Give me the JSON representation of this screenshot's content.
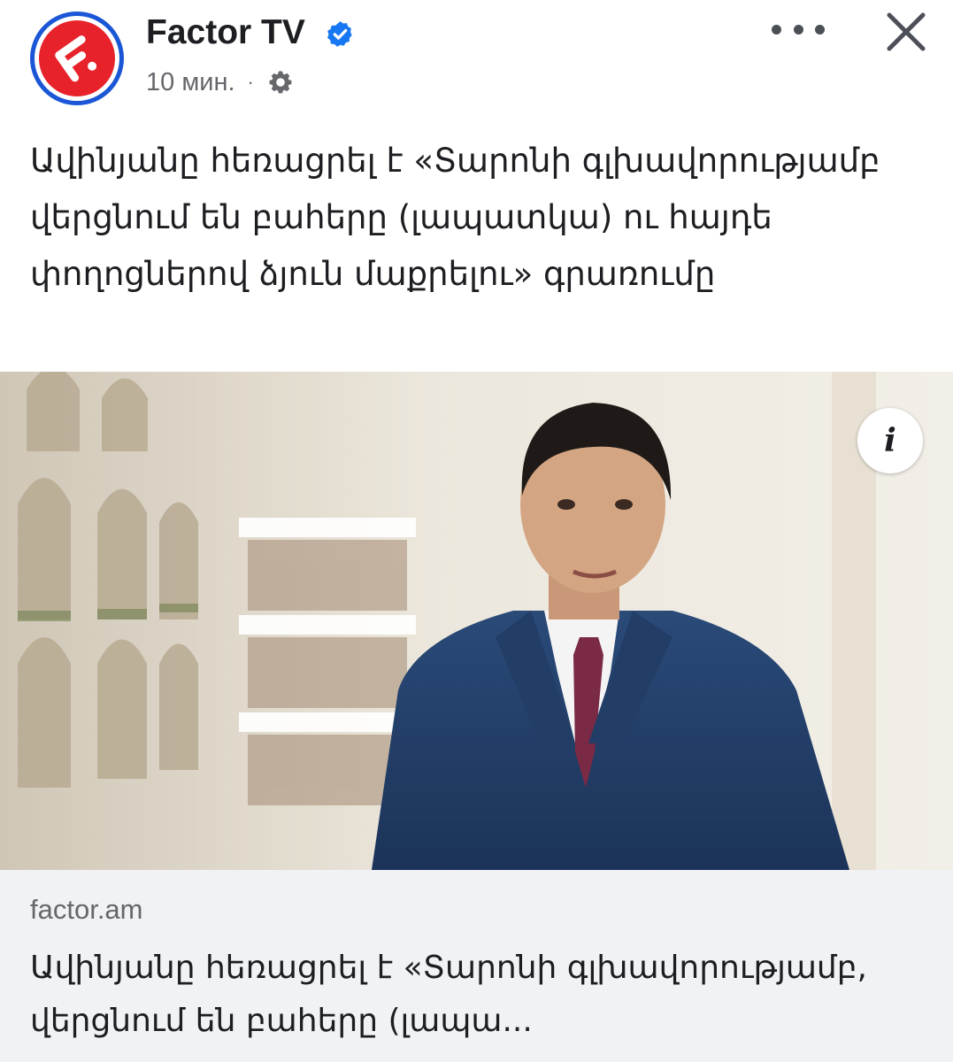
{
  "post": {
    "author": "Factor TV",
    "time": "10 мин.",
    "separator": "·",
    "text": "Ավինյանը հեռացրել է «Տարոնի գլխավորությամբ վերցնում են բահերը (լապատկա) ու հայդե փողոցներով ձյուն մաքրելու» գրառումը"
  },
  "icons": {
    "avatar": "factor-tv-logo",
    "verified": "verified-badge-icon",
    "privacy": "gear-icon",
    "more": "more-options-icon",
    "close": "close-icon",
    "info": "info-icon"
  },
  "image": {
    "info_label": "i"
  },
  "link_preview": {
    "domain": "factor.am",
    "title": "Ավինյանը հեռացրել է «Տարոնի գլխավորությամբ, վերցնում են բահերը (լապա..."
  },
  "colors": {
    "brand_red": "#e8222b",
    "avatar_ring": "#1a56d6",
    "verified_blue": "#1877f2",
    "muted_text": "#65676b",
    "preview_bg": "#f0f2f5"
  }
}
